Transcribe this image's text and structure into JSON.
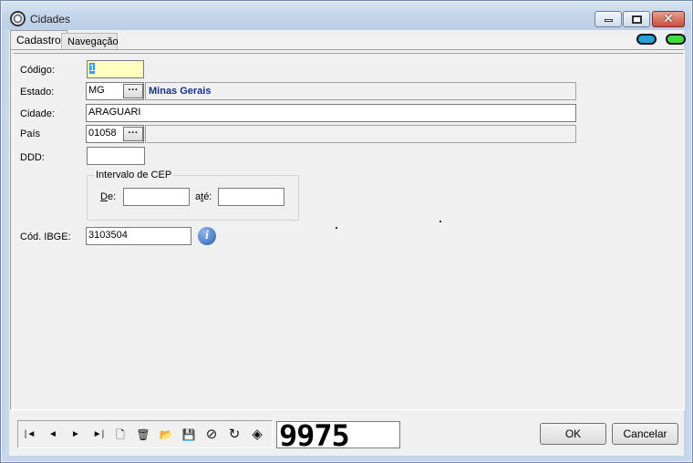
{
  "window": {
    "title": "Cidades",
    "close_glyph": "✕"
  },
  "tabs": [
    {
      "label": "Cadastro",
      "active": true
    },
    {
      "label": "Navegação",
      "active": false
    }
  ],
  "status_toggles": [
    {
      "name": "blue-toggle",
      "color": "#1fa3d8"
    },
    {
      "name": "green-toggle",
      "color": "#3fdb3f"
    }
  ],
  "form": {
    "codigo": {
      "label": "Código:",
      "value": "1"
    },
    "estado": {
      "label": "Estado:",
      "value": "MG",
      "button": "···",
      "description": "Minas Gerais"
    },
    "cidade": {
      "label": "Cidade:",
      "value": "ARAGUARI"
    },
    "pais": {
      "label": "País",
      "value": "01058",
      "button": "···",
      "description": ""
    },
    "ddd": {
      "label": "DDD:",
      "value": ""
    },
    "cep": {
      "group_label": "Intervalo de CEP",
      "de_label_u": "D",
      "de_label_rest": "e:",
      "ate_label_a": "a",
      "ate_label_u": "t",
      "ate_label_rest": "é:",
      "de_value": "",
      "ate_value": ""
    },
    "ibge": {
      "label": "Cód. IBGE:",
      "value": "3103504",
      "info_icon": "i"
    }
  },
  "navigator": {
    "buttons": [
      {
        "name": "first-record-icon",
        "glyph": "|◄"
      },
      {
        "name": "prior-record-icon",
        "glyph": "◄"
      },
      {
        "name": "next-record-icon",
        "glyph": "►"
      },
      {
        "name": "last-record-icon",
        "glyph": "►|"
      },
      {
        "name": "new-record-icon",
        "glyph": "🗋"
      },
      {
        "name": "delete-record-icon",
        "glyph": "🗑"
      },
      {
        "name": "open-folder-icon",
        "glyph": "📂"
      },
      {
        "name": "save-icon",
        "glyph": "💾"
      },
      {
        "name": "cancel-icon",
        "glyph": "⊘"
      },
      {
        "name": "refresh-icon",
        "glyph": "↻"
      },
      {
        "name": "gem-icon",
        "glyph": "◈"
      }
    ],
    "record_counter": "9975"
  },
  "actions": {
    "ok_label": "OK",
    "cancel_label": "Cancelar"
  }
}
